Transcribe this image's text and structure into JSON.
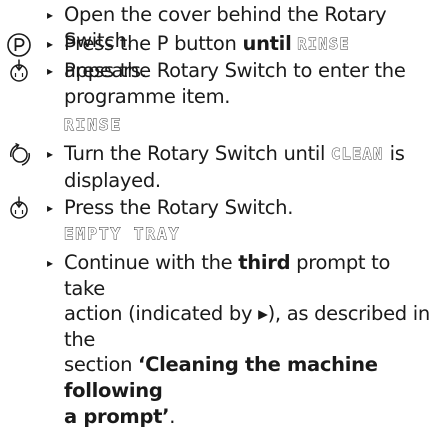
{
  "steps": [
    {
      "icon": "none",
      "text": "Open the cover behind the Rotary Switch."
    },
    {
      "icon": "p-button-icon",
      "pre": "Press the P button ",
      "bold": "until",
      "space": " ",
      "lcd": "RINSE",
      "post": " appears."
    },
    {
      "icon": "press-rotary-icon",
      "line1": "Press the Rotary Switch to enter the",
      "line2": "programme item."
    },
    {
      "display": "RINSE"
    },
    {
      "icon": "turn-rotary-icon",
      "pre": "Turn the Rotary Switch until ",
      "lcd": "CLEAN",
      "post": " is",
      "line2": "displayed."
    },
    {
      "icon": "press-rotary-icon",
      "text": "Press the Rotary Switch."
    },
    {
      "display": "EMPTY TRAY"
    },
    {
      "icon": "none",
      "pre": "Continue with the ",
      "bold": "third",
      "post": " prompt to take",
      "line2": "action (indicated by ▸), as described in the",
      "line3_pre": "section ",
      "line3_bold": "‘Cleaning the machine following",
      "line4_bold": "a prompt’",
      "line4_post": "."
    }
  ],
  "bullet_glyph": "▸"
}
